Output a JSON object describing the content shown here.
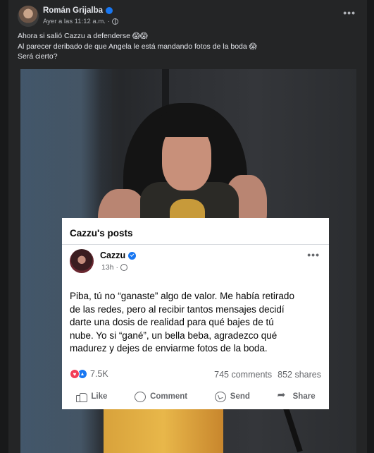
{
  "post": {
    "author": "Román Grijalba",
    "timestamp": "Ayer a las 11:12 a.m.",
    "separator": "·",
    "caption_lines": [
      "Ahora si salió Cazzu a defenderse 😱😱",
      "Al parecer deribado de que Angela le está mandando fotos de la boda 😱",
      "Será cierto?"
    ],
    "more_label": "•••"
  },
  "embedded": {
    "title": "Cazzu's posts",
    "author": "Cazzu",
    "time": "13h",
    "separator": "·",
    "more_label": "•••",
    "body_lines": [
      "Piba, tú no “ganaste” algo de valor. Me había retirado",
      "de las redes, pero al recibir tantos mensajes decidí",
      "darte una dosis de realidad para qué bajes de tú",
      "nube. Yo si “gané”, un bella beba, agradezco qué",
      "madurez y dejes de enviarme fotos de la boda."
    ],
    "reactions_count": "7.5K",
    "comments": "745 comments",
    "shares": "852 shares",
    "actions": {
      "like": "Like",
      "comment": "Comment",
      "send": "Send",
      "share": "Share"
    }
  },
  "colors": {
    "background": "#18191a",
    "post_bg": "#242526",
    "verified_blue": "#1877f2",
    "love_red": "#f33e58"
  },
  "icons": [
    "verified-badge-icon",
    "globe-icon",
    "more-options-icon",
    "like-icon",
    "comment-icon",
    "send-icon",
    "share-icon",
    "love-reaction-icon",
    "like-reaction-icon"
  ]
}
